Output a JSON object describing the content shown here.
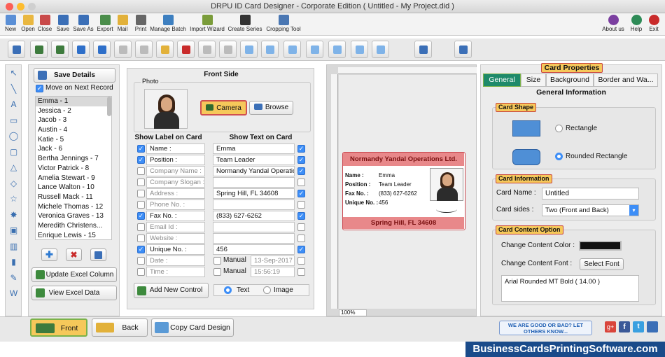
{
  "window": {
    "title": "DRPU ID Card Designer - Corporate Edition ( Untitled - My Project.did )"
  },
  "menu": {
    "items": [
      {
        "label": "New",
        "icon": "new-icon",
        "color": "#5a8fd6"
      },
      {
        "label": "Open",
        "icon": "open-folder-icon",
        "color": "#e9b740"
      },
      {
        "label": "Close",
        "icon": "close-doc-icon",
        "color": "#c94a4a"
      },
      {
        "label": "Save",
        "icon": "save-icon",
        "color": "#3b6fb7"
      },
      {
        "label": "Save As",
        "icon": "save-as-icon",
        "color": "#3b6fb7"
      },
      {
        "label": "Export",
        "icon": "export-icon",
        "color": "#4a8d4a"
      },
      {
        "label": "Mail",
        "icon": "mail-icon",
        "color": "#e2b13a"
      },
      {
        "label": "Print",
        "icon": "print-icon",
        "color": "#666666"
      },
      {
        "label": "Manage Batch",
        "icon": "batch-icon",
        "color": "#3d7fc0"
      },
      {
        "label": "Import Wizard",
        "icon": "import-wizard-icon",
        "color": "#7a9c3a"
      },
      {
        "label": "Create Series",
        "icon": "series-icon",
        "color": "#333333"
      },
      {
        "label": "Cropping Tool",
        "icon": "crop-icon",
        "color": "#4a77b3"
      }
    ],
    "right": [
      {
        "label": "About us",
        "icon": "about-icon",
        "color": "#7b3fa0"
      },
      {
        "label": "Help",
        "icon": "help-icon",
        "color": "#2e8b57"
      },
      {
        "label": "Exit",
        "icon": "exit-icon",
        "color": "#c92b2b"
      }
    ]
  },
  "records": {
    "save_details": "Save Details",
    "move_next": "Move on Next Record",
    "list": [
      "Emma - 1",
      "Jessica - 2",
      "Jacob - 3",
      "Austin - 4",
      "Katie - 5",
      "Jack - 6",
      "Bertha Jennings - 7",
      "Victor Patrick - 8",
      "Amelia Stewart - 9",
      "Lance Walton - 10",
      "Russell Mack - 11",
      "Michele Thomas - 12",
      "Veronica Graves - 13",
      "Meredith Christens...",
      "Enrique Lewis - 15"
    ],
    "update_excel": "Update Excel Column",
    "view_excel": "View Excel Data"
  },
  "front": {
    "title": "Front Side",
    "photo_label": "Photo",
    "camera": "Camera",
    "browse": "Browse",
    "col_label": "Show Label on Card",
    "col_text": "Show Text on Card",
    "rows": [
      {
        "label": "Name :",
        "value": "Emma",
        "label_on": true,
        "text_on": true
      },
      {
        "label": "Position :",
        "value": "Team Leader",
        "label_on": true,
        "text_on": true
      },
      {
        "label": "Company Name :",
        "value": "Normandy Yandal Operation",
        "label_on": false,
        "text_on": true
      },
      {
        "label": "Company Slogan :",
        "value": "",
        "label_on": false,
        "text_on": false
      },
      {
        "label": "Address :",
        "value": "Spring Hill, FL 34608",
        "label_on": false,
        "text_on": true
      },
      {
        "label": "Phone No. :",
        "value": "",
        "label_on": false,
        "text_on": false
      },
      {
        "label": "Fax No. :",
        "value": "(833) 627-6262",
        "label_on": true,
        "text_on": true
      },
      {
        "label": "Email Id :",
        "value": "",
        "label_on": false,
        "text_on": false
      },
      {
        "label": "Website :",
        "value": "",
        "label_on": false,
        "text_on": false
      },
      {
        "label": "Unique No. :",
        "value": "456",
        "label_on": true,
        "text_on": true
      }
    ],
    "date_label": "Date :",
    "time_label": "Time :",
    "manual": "Manual",
    "date_value": "13-Sep-2017",
    "time_value": "15:56:19",
    "add_control": "Add New Control",
    "text_opt": "Text",
    "image_opt": "Image"
  },
  "card": {
    "company": "Normandy Yandal Operations Ltd.",
    "rows": [
      {
        "k": "Name :",
        "v": "Emma"
      },
      {
        "k": "Position :",
        "v": "Team Leader"
      },
      {
        "k": "Fax No. :",
        "v": "(833) 627-6262"
      },
      {
        "k": "Unique No. :",
        "v": "456"
      }
    ],
    "address": "Spring Hill, FL 34608",
    "zoom": "100%",
    "accent": "#e8888a"
  },
  "props": {
    "title": "Card Properties",
    "tabs": [
      "General",
      "Size",
      "Background",
      "Border and Wa..."
    ],
    "section": "General Information",
    "shape_label": "Card Shape",
    "rect": "Rectangle",
    "rounded": "Rounded Rectangle",
    "info_label": "Card Information",
    "card_name_label": "Card Name :",
    "card_name_value": "Untitled",
    "card_sides_label": "Card sides :",
    "card_sides_value": "Two (Front and Back)",
    "content_label": "Card Content Option",
    "content_color": "Change Content Color :",
    "content_font": "Change Content Font :",
    "select_font": "Select Font",
    "font_value": "Arial Rounded MT Bold ( 14.00 )"
  },
  "bottom": {
    "front": "Front",
    "back": "Back",
    "copy": "Copy Card Design",
    "feedback": "WE ARE GOOD OR BAD? LET OTHERS KNOW..."
  },
  "footer": {
    "brand": "BusinessCardsPrintingSoftware.com"
  }
}
